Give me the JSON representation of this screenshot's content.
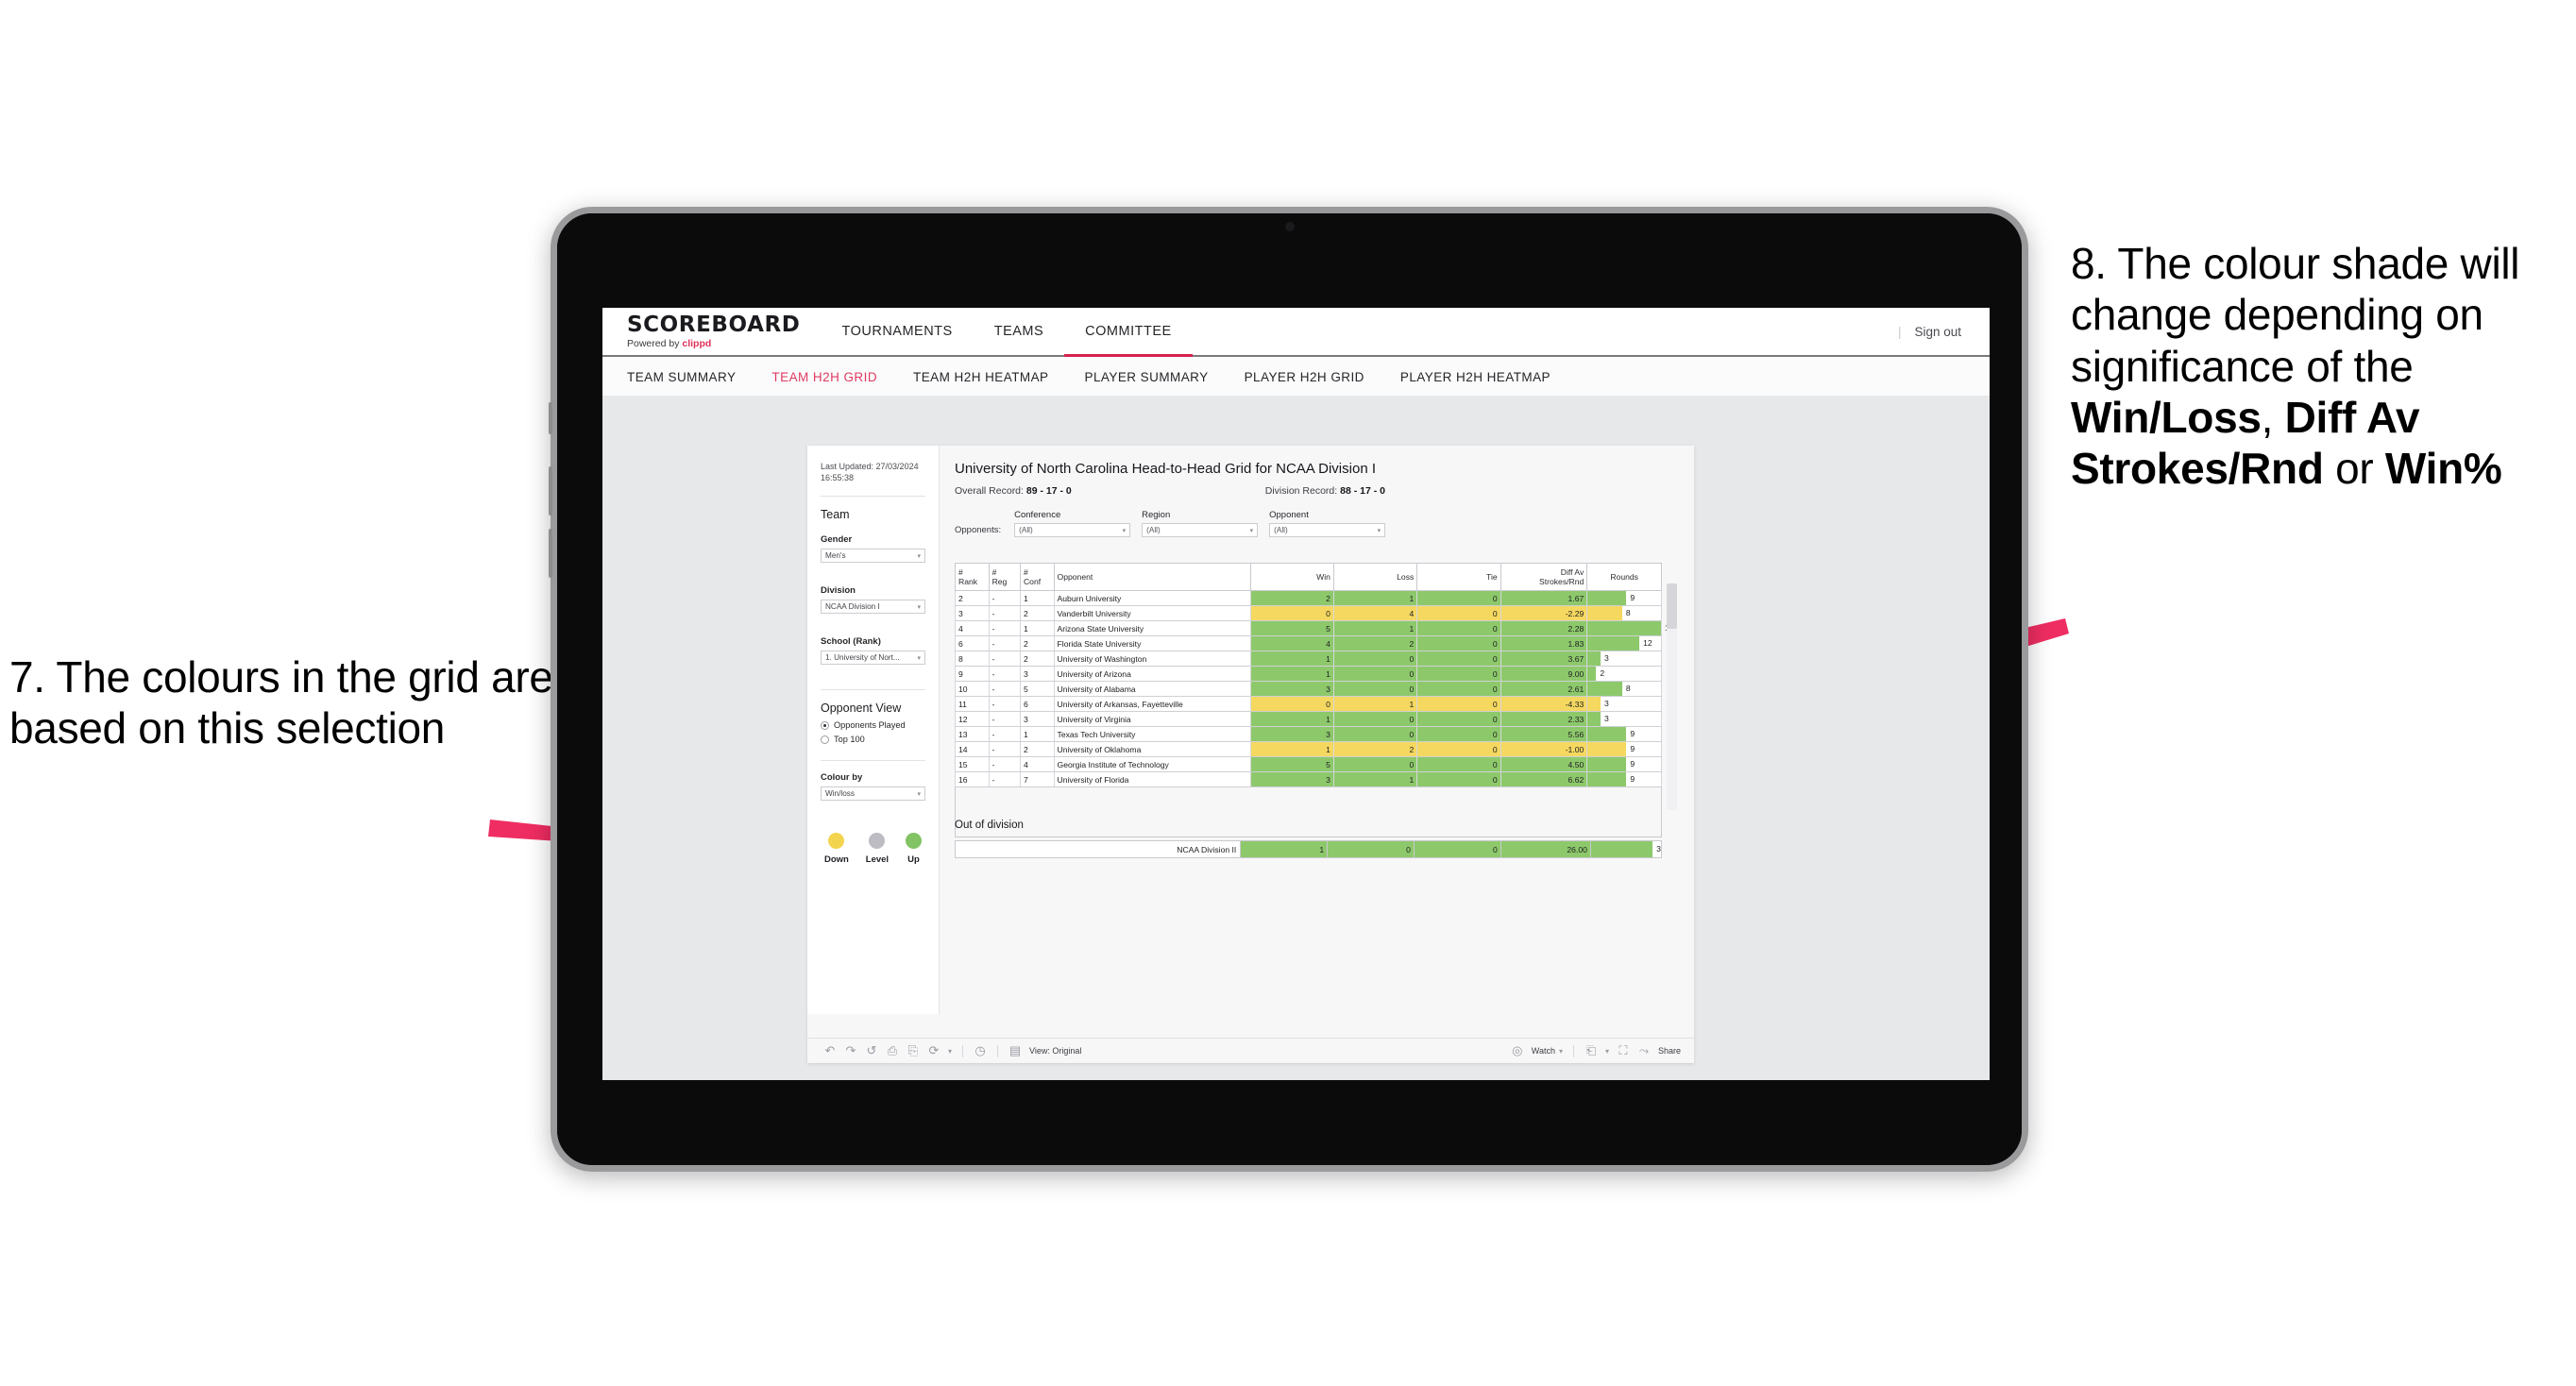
{
  "annotations": {
    "left": "7. The colours in the grid are based on this selection",
    "right_plain_1": "8. The colour shade will change depending on significance of the ",
    "right_bold_1": "Win/Loss",
    "right_plain_2": ", ",
    "right_bold_2": "Diff Av Strokes/Rnd",
    "right_plain_3": " or ",
    "right_bold_3": "Win%",
    "arrow_color": "#ef2d62"
  },
  "topnav": {
    "brand_main": "SCOREBOARD",
    "brand_sub_prefix": "Powered by ",
    "brand_sub_name": "clippd",
    "items": [
      {
        "label": "TOURNAMENTS",
        "active": false
      },
      {
        "label": "TEAMS",
        "active": false
      },
      {
        "label": "COMMITTEE",
        "active": true
      }
    ],
    "divider": "|",
    "signout": "Sign out",
    "accent": "#d6214d"
  },
  "subnav": {
    "items": [
      {
        "label": "TEAM SUMMARY",
        "active": false
      },
      {
        "label": "TEAM H2H GRID",
        "active": true
      },
      {
        "label": "TEAM H2H HEATMAP",
        "active": false
      },
      {
        "label": "PLAYER SUMMARY",
        "active": false
      },
      {
        "label": "PLAYER H2H GRID",
        "active": false
      },
      {
        "label": "PLAYER H2H HEATMAP",
        "active": false
      }
    ]
  },
  "panel": {
    "last_updated": "Last Updated: 27/03/2024 16:55:38",
    "team_heading": "Team",
    "gender_label": "Gender",
    "gender_value": "Men's",
    "division_label": "Division",
    "division_value": "NCAA Division I",
    "school_label": "School (Rank)",
    "school_value": "1. University of Nort...",
    "opponent_view_heading": "Opponent View",
    "opponent_view_options": [
      {
        "label": "Opponents Played",
        "selected": true
      },
      {
        "label": "Top 100",
        "selected": false
      }
    ],
    "colour_by_label": "Colour by",
    "colour_by_value": "Win/loss",
    "legend": [
      {
        "label": "Down",
        "color": "#f3d44f"
      },
      {
        "label": "Level",
        "color": "#bcbcc2"
      },
      {
        "label": "Up",
        "color": "#82c364"
      }
    ]
  },
  "viz": {
    "title": "University of North Carolina Head-to-Head Grid for NCAA Division I",
    "overall_record_label": "Overall Record: ",
    "overall_record_value": "89 - 17 - 0",
    "division_record_label": "Division Record: ",
    "division_record_value": "88 - 17 - 0",
    "opponents_label": "Opponents:",
    "filters": [
      {
        "title": "Conference",
        "value": "(All)"
      },
      {
        "title": "Region",
        "value": "(All)"
      },
      {
        "title": "Opponent",
        "value": "(All)"
      }
    ],
    "columns": [
      "# Rank",
      "# Reg",
      "# Conf",
      "Opponent",
      "Win",
      "Loss",
      "Tie",
      "Diff Av Strokes/Rnd",
      "Rounds"
    ],
    "column_lines": [
      [
        "#",
        "Rank"
      ],
      [
        "#",
        "Reg"
      ],
      [
        "#",
        "Conf"
      ],
      [
        "",
        "Opponent"
      ],
      [
        "",
        "Win"
      ],
      [
        "",
        "Loss"
      ],
      [
        "",
        "Tie"
      ],
      [
        "Diff Av",
        "Strokes/Rnd"
      ],
      [
        "",
        "Rounds"
      ]
    ],
    "rounds_max": 17,
    "colors": {
      "up": "#8dc96b",
      "down": "#f5d860",
      "level": "#bcbcc2"
    },
    "rows": [
      {
        "rank": "2",
        "reg": "-",
        "conf": "1",
        "opponent": "Auburn University",
        "win": "2",
        "loss": "1",
        "tie": "0",
        "diff": "1.67",
        "rounds": "9",
        "tone": "up"
      },
      {
        "rank": "3",
        "reg": "-",
        "conf": "2",
        "opponent": "Vanderbilt University",
        "win": "0",
        "loss": "4",
        "tie": "0",
        "diff": "-2.29",
        "rounds": "8",
        "tone": "down"
      },
      {
        "rank": "4",
        "reg": "-",
        "conf": "1",
        "opponent": "Arizona State University",
        "win": "5",
        "loss": "1",
        "tie": "0",
        "diff": "2.28",
        "rounds": "17",
        "tone": "up"
      },
      {
        "rank": "6",
        "reg": "-",
        "conf": "2",
        "opponent": "Florida State University",
        "win": "4",
        "loss": "2",
        "tie": "0",
        "diff": "1.83",
        "rounds": "12",
        "tone": "up"
      },
      {
        "rank": "8",
        "reg": "-",
        "conf": "2",
        "opponent": "University of Washington",
        "win": "1",
        "loss": "0",
        "tie": "0",
        "diff": "3.67",
        "rounds": "3",
        "tone": "up"
      },
      {
        "rank": "9",
        "reg": "-",
        "conf": "3",
        "opponent": "University of Arizona",
        "win": "1",
        "loss": "0",
        "tie": "0",
        "diff": "9.00",
        "rounds": "2",
        "tone": "up"
      },
      {
        "rank": "10",
        "reg": "-",
        "conf": "5",
        "opponent": "University of Alabama",
        "win": "3",
        "loss": "0",
        "tie": "0",
        "diff": "2.61",
        "rounds": "8",
        "tone": "up"
      },
      {
        "rank": "11",
        "reg": "-",
        "conf": "6",
        "opponent": "University of Arkansas, Fayetteville",
        "win": "0",
        "loss": "1",
        "tie": "0",
        "diff": "-4.33",
        "rounds": "3",
        "tone": "down"
      },
      {
        "rank": "12",
        "reg": "-",
        "conf": "3",
        "opponent": "University of Virginia",
        "win": "1",
        "loss": "0",
        "tie": "0",
        "diff": "2.33",
        "rounds": "3",
        "tone": "up"
      },
      {
        "rank": "13",
        "reg": "-",
        "conf": "1",
        "opponent": "Texas Tech University",
        "win": "3",
        "loss": "0",
        "tie": "0",
        "diff": "5.56",
        "rounds": "9",
        "tone": "up"
      },
      {
        "rank": "14",
        "reg": "-",
        "conf": "2",
        "opponent": "University of Oklahoma",
        "win": "1",
        "loss": "2",
        "tie": "0",
        "diff": "-1.00",
        "rounds": "9",
        "tone": "down"
      },
      {
        "rank": "15",
        "reg": "-",
        "conf": "4",
        "opponent": "Georgia Institute of Technology",
        "win": "5",
        "loss": "0",
        "tie": "0",
        "diff": "4.50",
        "rounds": "9",
        "tone": "up"
      },
      {
        "rank": "16",
        "reg": "-",
        "conf": "7",
        "opponent": "University of Florida",
        "win": "3",
        "loss": "1",
        "tie": "0",
        "diff": "6.62",
        "rounds": "9",
        "tone": "up"
      }
    ],
    "out_of_division_title": "Out of division",
    "out_of_division_rows": [
      {
        "opponent": "NCAA Division II",
        "win": "1",
        "loss": "0",
        "tie": "0",
        "diff": "26.00",
        "rounds": "3",
        "tone": "up"
      }
    ]
  },
  "toolbar": {
    "view_label": "View: Original",
    "watch_label": "Watch",
    "share_label": "Share",
    "icons": [
      "undo-icon",
      "redo-icon",
      "revert-icon",
      "refresh-icon",
      "pause-icon",
      "reset-icon",
      "clock-icon",
      "view-icon",
      "watch-icon",
      "download-icon",
      "fullscreen-icon",
      "share-icon"
    ]
  }
}
